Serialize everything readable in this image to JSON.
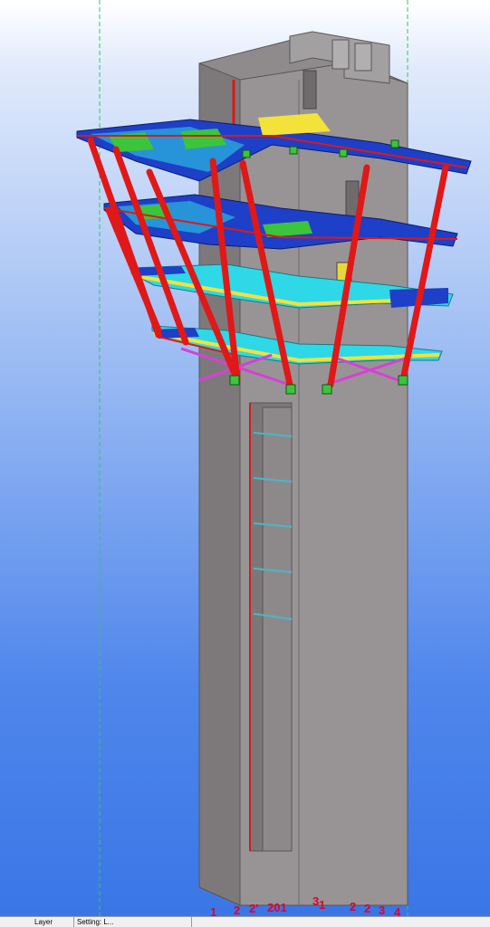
{
  "viewport": {
    "name": "3D model view",
    "colors": {
      "bg_top": "#ffffff",
      "bg_bottom": "#3a76e6",
      "concrete": "#8f8b8c",
      "steel_beam": "#1e3fc8",
      "column": "#e01818",
      "brace": "#d83fd8",
      "plate": "#f2e23a",
      "cyan": "#2fd8e6",
      "green": "#3cc43c",
      "grid_line": "#31c95a"
    }
  },
  "grid_labels": [
    "1",
    "2",
    "2'",
    "201",
    "3",
    "1",
    "2",
    "2",
    "3",
    "4"
  ],
  "statusbar": {
    "cell1": "Layer",
    "cell2": "Setting: L..."
  }
}
